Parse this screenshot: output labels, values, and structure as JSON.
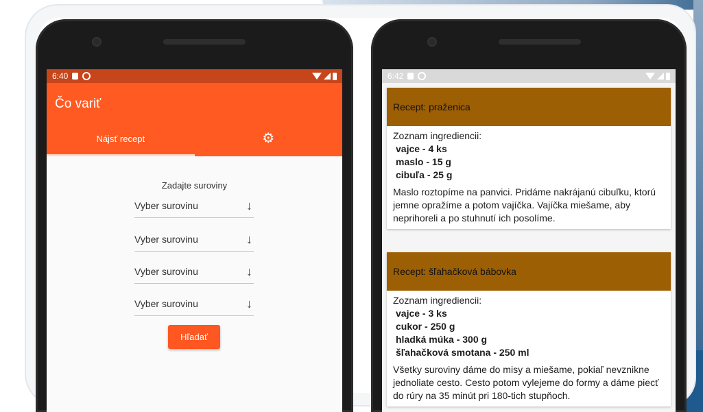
{
  "left_phone": {
    "status": {
      "time": "6:40"
    },
    "app_title": "Čo variť",
    "tabs": [
      {
        "label": "Nájsť recept"
      }
    ],
    "settings_icon": "gear-icon",
    "accent": "#ff5a22",
    "form": {
      "label": "Zadajte suroviny",
      "selects": [
        {
          "value": "Vyber surovinu"
        },
        {
          "value": "Vyber surovinu"
        },
        {
          "value": "Vyber surovinu"
        },
        {
          "value": "Vyber surovinu"
        }
      ],
      "search_button": "Hľadať"
    }
  },
  "right_phone": {
    "status": {
      "time": "6:42"
    },
    "header_color": "#9d5f04",
    "recipes": [
      {
        "title": "Recept: praženica",
        "ingredients_label": "Zoznam ingrediencii:",
        "ingredients": [
          "vajce - 4 ks",
          "maslo - 15 g",
          "cibuľa - 25 g"
        ],
        "instructions": "Maslo roztopíme na panvici. Pridáme nakrájanú cibuľku, ktorú jemne opražíme a potom vajíčka. Vajíčka miešame, aby neprihoreli a po stuhnutí ich posolíme."
      },
      {
        "title": "Recept: šľahačková bábovka",
        "ingredients_label": "Zoznam ingrediencii:",
        "ingredients": [
          "vajce - 3 ks",
          "cukor - 250 g",
          "hladká múka - 300 g",
          "šľahačková smotana - 250 ml"
        ],
        "instructions": "Všetky suroviny dáme do misy a miešame, pokiaľ nevznikne jednoliate cesto. Cesto potom vylejeme do formy a dáme piecť do rúry na 35 minút pri 180-tich stupňoch."
      }
    ]
  }
}
